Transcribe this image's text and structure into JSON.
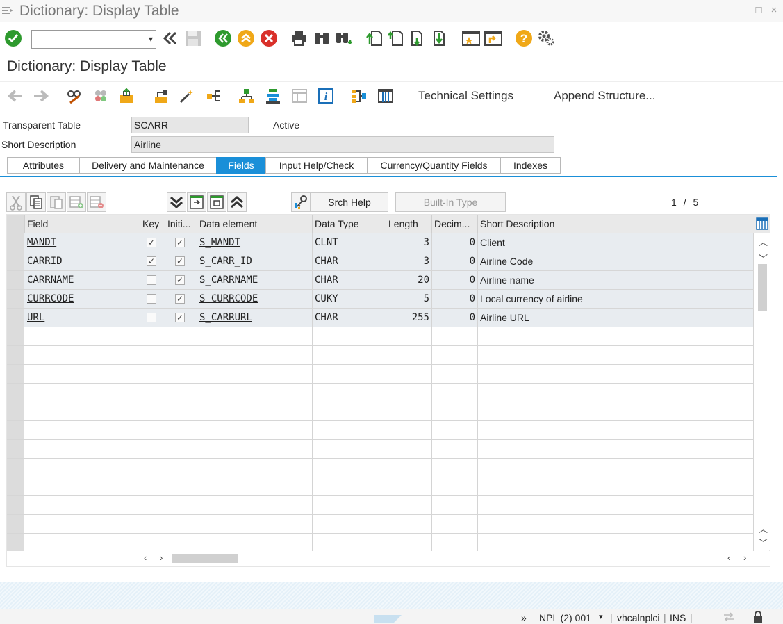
{
  "window": {
    "title": "Dictionary: Display Table",
    "minimize": "_",
    "maximize": "□",
    "close": "×"
  },
  "toolbar": {
    "command_field_value": "",
    "icons": [
      "enter-icon",
      "back-double-icon",
      "save-icon",
      "back-icon",
      "exit-icon",
      "cancel-icon",
      "print-icon",
      "find-icon",
      "find-next-icon",
      "first-page-icon",
      "previous-page-icon",
      "next-page-icon",
      "last-page-icon",
      "create-session-icon",
      "shortcut-icon",
      "help-icon",
      "settings-icon"
    ]
  },
  "screen": {
    "title": "Dictionary: Display Table"
  },
  "app_toolbar": {
    "technical_settings": "Technical Settings",
    "append_structure": "Append Structure..."
  },
  "header": {
    "table_type_label": "Transparent Table",
    "table_name": "SCARR",
    "status": "Active",
    "short_desc_label": "Short Description",
    "short_desc_value": "Airline"
  },
  "tabs": [
    {
      "label": "Attributes",
      "active": false
    },
    {
      "label": "Delivery and Maintenance",
      "active": false
    },
    {
      "label": "Fields",
      "active": true
    },
    {
      "label": "Input Help/Check",
      "active": false
    },
    {
      "label": "Currency/Quantity Fields",
      "active": false
    },
    {
      "label": "Indexes",
      "active": false
    }
  ],
  "table_toolbar": {
    "srch_help": "Srch Help",
    "built_in_type": "Built-In Type",
    "pager_current": "1",
    "pager_sep": "/",
    "pager_total": "5"
  },
  "grid": {
    "columns": [
      "Field",
      "Key",
      "Initi...",
      "Data element",
      "Data Type",
      "Length",
      "Decim...",
      "Short Description"
    ],
    "rows": [
      {
        "field": "MANDT",
        "key": true,
        "initial": true,
        "data_element": "S_MANDT",
        "data_type": "CLNT",
        "length": "3",
        "decimals": "0",
        "description": "Client"
      },
      {
        "field": "CARRID",
        "key": true,
        "initial": true,
        "data_element": "S_CARR_ID",
        "data_type": "CHAR",
        "length": "3",
        "decimals": "0",
        "description": "Airline Code"
      },
      {
        "field": "CARRNAME",
        "key": false,
        "initial": true,
        "data_element": "S_CARRNAME",
        "data_type": "CHAR",
        "length": "20",
        "decimals": "0",
        "description": "Airline name"
      },
      {
        "field": "CURRCODE",
        "key": false,
        "initial": true,
        "data_element": "S_CURRCODE",
        "data_type": "CUKY",
        "length": "5",
        "decimals": "0",
        "description": "Local currency of airline"
      },
      {
        "field": "URL",
        "key": false,
        "initial": true,
        "data_element": "S_CARRURL",
        "data_type": "CHAR",
        "length": "255",
        "decimals": "0",
        "description": "Airline URL"
      }
    ],
    "empty_rows": 12
  },
  "statusbar": {
    "expand": "»",
    "system": "NPL (2) 001",
    "server": "vhcalnplci",
    "mode": "INS"
  },
  "colors": {
    "accent": "#1a8fd8",
    "enter_green": "#2e9a2e",
    "nav_green": "#2e9a2e",
    "exit_orange": "#f0a818",
    "cancel_red": "#d9302a",
    "help_orange": "#f0a818"
  }
}
